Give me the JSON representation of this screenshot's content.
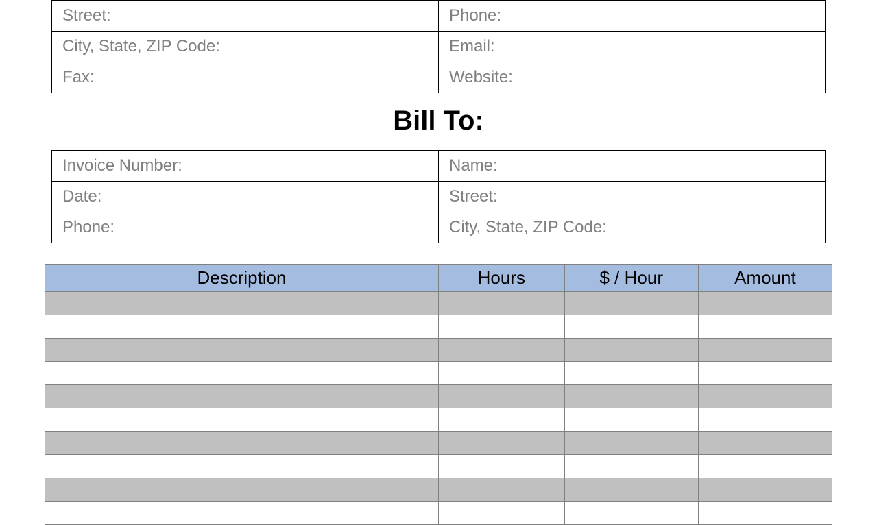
{
  "company_info": {
    "street": "Street:",
    "phone": "Phone:",
    "city_state_zip": "City, State, ZIP Code:",
    "email": "Email:",
    "fax": "Fax:",
    "website": "Website:"
  },
  "section_title": "Bill To:",
  "bill_to": {
    "invoice_number": "Invoice Number:",
    "name": "Name:",
    "date": "Date:",
    "street": "Street:",
    "phone": "Phone:",
    "city_state_zip": "City, State, ZIP Code:"
  },
  "items_header": {
    "description": "Description",
    "hours": "Hours",
    "rate": "$ / Hour",
    "amount": "Amount"
  }
}
